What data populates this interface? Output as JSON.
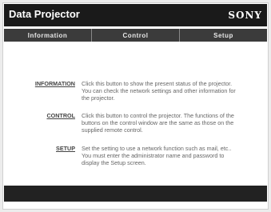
{
  "header": {
    "title": "Data Projector",
    "brand": "SONY"
  },
  "tabs": [
    {
      "label": "Information"
    },
    {
      "label": "Control"
    },
    {
      "label": "Setup"
    }
  ],
  "menu": [
    {
      "link": "INFORMATION",
      "description": "Click this button to show the present status of the projector. You can check the network settings and other information for the projector."
    },
    {
      "link": "CONTROL",
      "description": "Click this button to control the projector. The functions of the buttons on the control window are the same as those on the supplied remote control."
    },
    {
      "link": "SETUP",
      "description": "Set the setting to use a network function such as mail, etc.. You must enter the administrator name and password to display the Setup screen."
    }
  ],
  "colors": {
    "header_bg": "#1a1a1a",
    "tab_bg": "#3b3b3b",
    "footer_bg": "#222222"
  }
}
